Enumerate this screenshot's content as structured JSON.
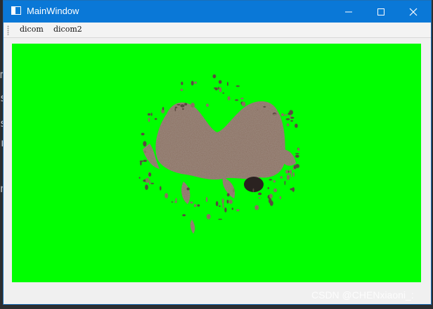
{
  "window": {
    "title": "MainWindow",
    "controls": {
      "minimize": "minimize-icon",
      "maximize": "maximize-icon",
      "close": "close-icon"
    }
  },
  "toolbar": {
    "items": [
      {
        "label": "dicom"
      },
      {
        "label": "dicom2"
      }
    ]
  },
  "viewport": {
    "background_color": "#00ff00",
    "render_color": "#8a7060",
    "render_shadow_color": "#2a2220"
  },
  "background_editor": {
    "glyphs": [
      "m",
      "s",
      "s",
      "r",
      "n"
    ]
  },
  "watermark": {
    "text": "CSDN @CHENxiaoni_:"
  }
}
